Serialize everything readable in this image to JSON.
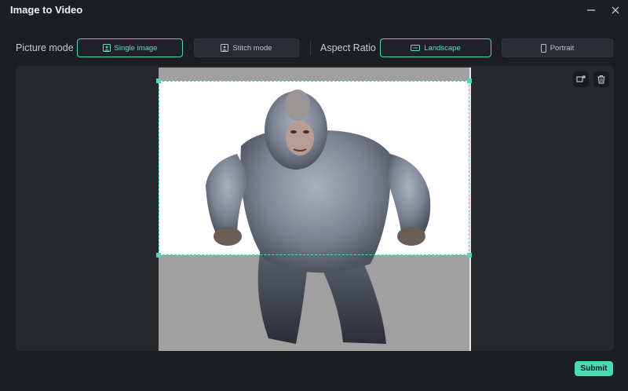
{
  "window": {
    "title": "Image to Video",
    "minimize_icon": "minimize-icon",
    "close_icon": "close-icon"
  },
  "picture_mode": {
    "label": "Picture mode",
    "options": [
      {
        "label": "Single image",
        "icon": "image-icon",
        "selected": true
      },
      {
        "label": "Stitch mode",
        "icon": "stitch-icon",
        "selected": false
      }
    ]
  },
  "aspect_ratio": {
    "label": "Aspect Ratio",
    "options": [
      {
        "label": "Landscape",
        "icon": "landscape-icon",
        "selected": true
      },
      {
        "label": "Portrait",
        "icon": "portrait-icon",
        "selected": false
      }
    ]
  },
  "preview": {
    "tools": [
      "replace-image-icon",
      "trash-icon"
    ]
  },
  "footer": {
    "submit_label": "Submit"
  },
  "colors": {
    "accent": "#4fd8b6",
    "background": "#1c1e22",
    "panel": "#26282c"
  }
}
